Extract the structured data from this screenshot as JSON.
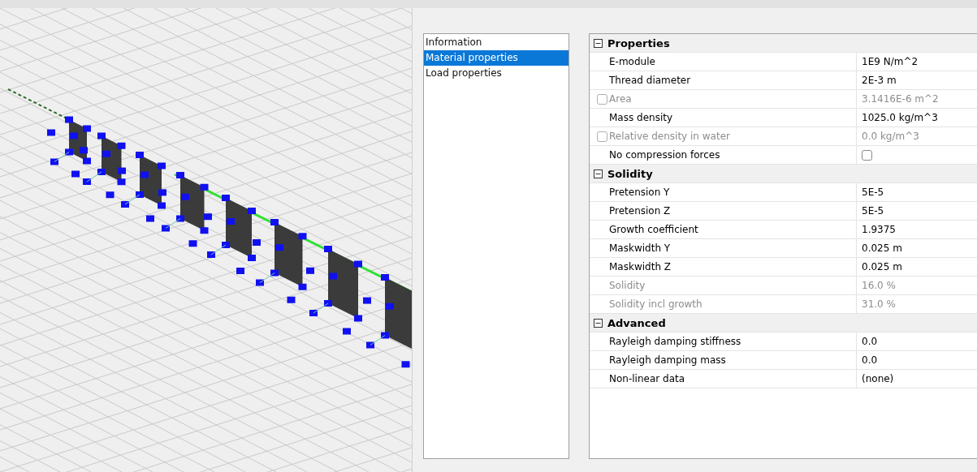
{
  "sections": [
    {
      "label": "Information",
      "selected": false
    },
    {
      "label": "Material properties",
      "selected": true
    },
    {
      "label": "Load properties",
      "selected": false
    }
  ],
  "property_grid": [
    {
      "title": "Properties",
      "expanded": true,
      "rows": [
        {
          "name": "E-module",
          "value": "1E9 N/m^2",
          "disabled": false
        },
        {
          "name": "Thread diameter",
          "value": "2E-3 m",
          "disabled": false
        },
        {
          "name": "Area",
          "value": "3.1416E-6 m^2",
          "disabled": true,
          "checkbox": {
            "checked": false
          }
        },
        {
          "name": "Mass density",
          "value": "1025.0 kg/m^3",
          "disabled": false
        },
        {
          "name": "Relative density in water",
          "value": "0.0 kg/m^3",
          "disabled": true,
          "checkbox": {
            "checked": false
          }
        },
        {
          "name": "No compression forces",
          "kind": "checkbox",
          "checked": false,
          "disabled": false
        }
      ]
    },
    {
      "title": "Solidity",
      "expanded": true,
      "rows": [
        {
          "name": "Pretension Y",
          "value": "5E-5",
          "disabled": false
        },
        {
          "name": "Pretension Z",
          "value": "5E-5",
          "disabled": false
        },
        {
          "name": "Growth coefficient",
          "value": "1.9375",
          "disabled": false
        },
        {
          "name": "Maskwidth Y",
          "value": "0.025 m",
          "disabled": false
        },
        {
          "name": "Maskwidth Z",
          "value": "0.025 m",
          "disabled": false
        },
        {
          "name": "Solidity",
          "value": "16.0 %",
          "disabled": true
        },
        {
          "name": "Solidity incl growth",
          "value": "31.0 %",
          "disabled": true
        }
      ]
    },
    {
      "title": "Advanced",
      "expanded": true,
      "rows": [
        {
          "name": "Rayleigh damping stiffness",
          "value": "0.0",
          "disabled": false
        },
        {
          "name": "Rayleigh damping mass",
          "value": "0.0",
          "disabled": false
        },
        {
          "name": "Non-linear data",
          "value": "(none)",
          "disabled": false
        }
      ]
    }
  ]
}
